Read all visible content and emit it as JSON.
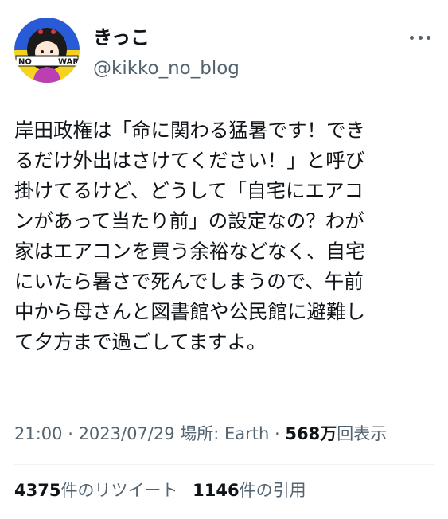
{
  "author": {
    "display_name": "きっこ",
    "handle": "@kikko_no_blog",
    "avatar": {
      "icon": "avatar-icon",
      "banner_left": "NO",
      "banner_right": "WAR",
      "colors": {
        "top": "#2a5bd7",
        "bottom": "#f5d31c",
        "banner": "#ffffff"
      }
    }
  },
  "tweet": {
    "lines": [
      "岸田政権は「命に関わる猛暑です！でき",
      "るだけ外出はさけてください！」と呼び",
      "掛けてるけど、どうして「自宅にエアコ",
      "ンがあって当たり前」の設定なの？わが",
      "家はエアコンを買う余裕などなく、自宅",
      "にいたら暑さで死んでしまうので、午前",
      "中から母さんと図書館や公民館に避難し",
      "て夕方まで過ごしてますよ。"
    ]
  },
  "meta": {
    "time": "21:00",
    "sep1": " · ",
    "date": "2023/07/29",
    "location": " 場所: Earth",
    "sep2": " · ",
    "views_count": "568万",
    "views_label": "回表示"
  },
  "stats": {
    "retweets_count": "4375",
    "retweets_label": "件のリツイート",
    "quotes_count": "1146",
    "quotes_label": "件の引用"
  },
  "colors": {
    "text_primary": "#0f1419",
    "text_secondary": "#536471",
    "divider": "#eff3f4"
  }
}
